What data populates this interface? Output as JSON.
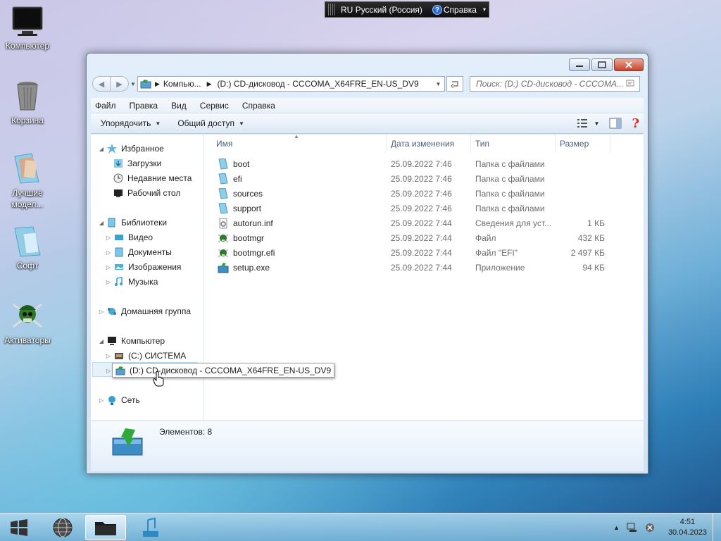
{
  "desktop": {
    "icons": [
      {
        "label": "Компьютер",
        "icon": "monitor-icon"
      },
      {
        "label": "Корзина",
        "icon": "recycle-bin-icon"
      },
      {
        "label": "Лучшие модел...",
        "icon": "folder-photos-icon"
      },
      {
        "label": "Софт",
        "icon": "folder-icon"
      },
      {
        "label": "Активаторы",
        "icon": "pirate-icon"
      }
    ]
  },
  "langbar": {
    "lang_code": "RU",
    "lang_name": "Русский (Россия)",
    "help": "Справка"
  },
  "window": {
    "address": {
      "segments": [
        "Компью...",
        "(D:) CD-дисковод - CCCOMA_X64FRE_EN-US_DV9"
      ]
    },
    "search_placeholder": "Поиск: (D:) CD-дисковод - CCCOMA...",
    "menu": [
      "Файл",
      "Правка",
      "Вид",
      "Сервис",
      "Справка"
    ],
    "toolbar": {
      "organize": "Упорядочить",
      "share": "Общий доступ"
    },
    "nav": {
      "favorites": "Избранное",
      "downloads": "Загрузки",
      "recent": "Недавние места",
      "desktop": "Рабочий стол",
      "libraries": "Библиотеки",
      "video": "Видео",
      "documents": "Документы",
      "images": "Изображения",
      "music": "Музыка",
      "homegroup": "Домашняя группа",
      "computer": "Компьютер",
      "drive_c": "(C:) СИСТЕМА",
      "drive_d": "(D:) CD-дисковод - CCCOMA_X64FRE_EN-US_DV9",
      "network": "Сеть"
    },
    "columns": {
      "name": "Имя",
      "date": "Дата изменения",
      "type": "Тип",
      "size": "Размер"
    },
    "files": [
      {
        "name": "boot",
        "date": "25.09.2022 7:46",
        "type": "Папка с файлами",
        "size": "",
        "icon": "folder-icon"
      },
      {
        "name": "efi",
        "date": "25.09.2022 7:46",
        "type": "Папка с файлами",
        "size": "",
        "icon": "folder-icon"
      },
      {
        "name": "sources",
        "date": "25.09.2022 7:46",
        "type": "Папка с файлами",
        "size": "",
        "icon": "folder-icon"
      },
      {
        "name": "support",
        "date": "25.09.2022 7:46",
        "type": "Папка с файлами",
        "size": "",
        "icon": "folder-icon"
      },
      {
        "name": "autorun.inf",
        "date": "25.09.2022 7:44",
        "type": "Сведения для уст...",
        "size": "1 КБ",
        "icon": "settings-file-icon"
      },
      {
        "name": "bootmgr",
        "date": "25.09.2022 7:44",
        "type": "Файл",
        "size": "432 КБ",
        "icon": "pirate-file-icon"
      },
      {
        "name": "bootmgr.efi",
        "date": "25.09.2022 7:44",
        "type": "Файл \"EFI\"",
        "size": "2 497 КБ",
        "icon": "pirate-file-icon"
      },
      {
        "name": "setup.exe",
        "date": "25.09.2022 7:44",
        "type": "Приложение",
        "size": "94 КБ",
        "icon": "setup-icon"
      }
    ],
    "status": "Элементов: 8"
  },
  "taskbar": {
    "time": "4:51",
    "date": "30.04.2023"
  },
  "colors": {
    "accent": "#2a6bd6",
    "folder": "#7fc6e8"
  }
}
